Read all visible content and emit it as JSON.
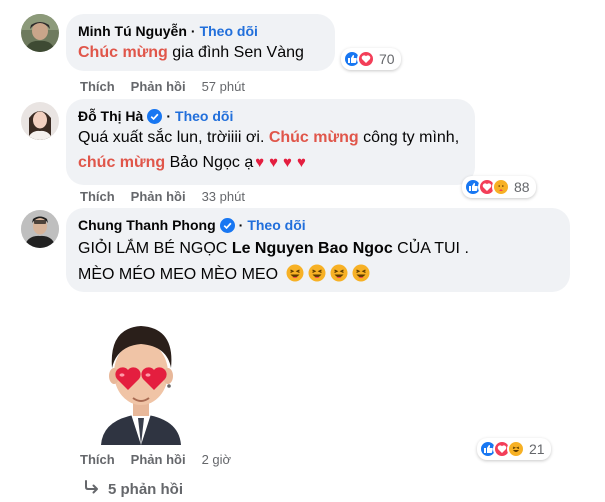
{
  "comments": [
    {
      "author": "Minh Tú Nguyễn",
      "follow": "Theo dõi",
      "text_parts": [
        {
          "t": "Chúc mừng",
          "hl": true
        },
        {
          "t": " gia đình Sen Vàng",
          "hl": false
        }
      ],
      "like": "Thích",
      "reply": "Phản hồi",
      "time": "57 phút",
      "reaction_count": "70",
      "reactions": [
        "like-icon",
        "love-icon"
      ]
    },
    {
      "author": "Đỗ Thị Hà",
      "verified": true,
      "follow": "Theo dõi",
      "line1": [
        {
          "t": "Quá xuất sắc lun, trờiiii ơi. ",
          "hl": false
        },
        {
          "t": "Chúc mừng",
          "hl": true
        },
        {
          "t": " công ty mình,",
          "hl": false
        }
      ],
      "line2": [
        {
          "t": "chúc mừng",
          "hl": true
        },
        {
          "t": " Bảo Ngọc ạ",
          "hl": false
        }
      ],
      "hearts": "♥♥♥♥",
      "like": "Thích",
      "reply": "Phản hồi",
      "time": "33 phút",
      "reaction_count": "88",
      "reactions": [
        "like-icon",
        "love-icon",
        "care-icon"
      ]
    },
    {
      "author": "Chung Thanh Phong",
      "verified": true,
      "follow": "Theo dõi",
      "line1_pre": "GIỎI LẮM BÉ NGỌC ",
      "mention": "Le Nguyen Bao Ngoc",
      "line1_post": " CỦA TUI .",
      "line2": "MÈO MÉO MEO MÈO MEO",
      "like": "Thích",
      "reply": "Phản hồi",
      "time": "2 giờ",
      "reaction_count": "21",
      "reactions": [
        "like-icon",
        "love-icon",
        "haha-icon"
      ]
    }
  ],
  "view_replies": "5 phản hồi",
  "sep": "·",
  "colors": {
    "highlight": "#e0564a",
    "follow": "#216fdb",
    "bubble": "#f0f2f5",
    "muted": "#65676b",
    "like_blue": "#1877f2",
    "love_red": "#f33e58"
  }
}
